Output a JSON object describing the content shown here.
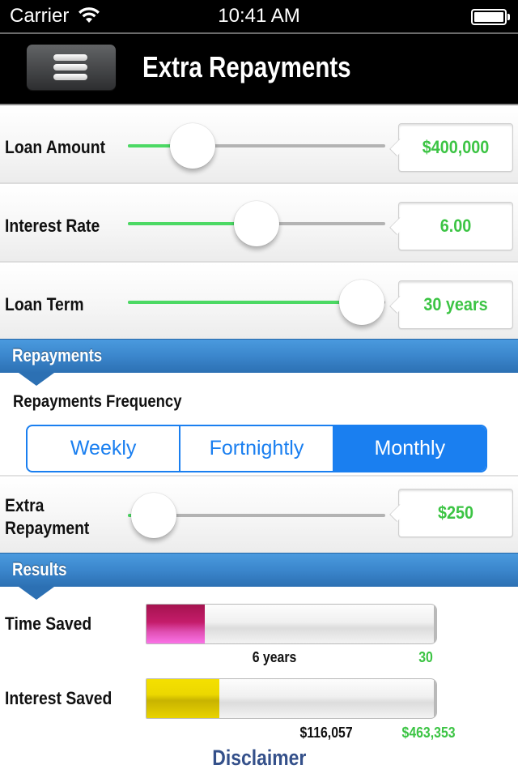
{
  "status_bar": {
    "carrier": "Carrier",
    "time": "10:41 AM",
    "battery_level": 1.0
  },
  "nav": {
    "title": "Extra Repayments",
    "menu_icon": "hamburger-menu-icon"
  },
  "sliders": {
    "loan_amount": {
      "label": "Loan Amount",
      "value": "$400,000",
      "fraction": 0.25
    },
    "interest_rate": {
      "label": "Interest Rate",
      "value": "6.00",
      "fraction": 0.5
    },
    "loan_term": {
      "label": "Loan Term",
      "value": "30 years",
      "fraction": 0.91
    },
    "extra_repayment": {
      "label_line1": "Extra",
      "label_line2": "Repayment",
      "value": "$250",
      "fraction": 0.1
    }
  },
  "repayments_section": {
    "title": "Repayments",
    "frequency_label": "Repayments Frequency",
    "options": [
      "Weekly",
      "Fortnightly",
      "Monthly"
    ],
    "selected": "Monthly"
  },
  "results_section": {
    "title": "Results",
    "time_saved": {
      "label": "Time Saved",
      "value": "6 years",
      "max": "30",
      "fraction": 0.2
    },
    "interest_saved": {
      "label": "Interest Saved",
      "value": "$116,057",
      "max": "$463,353",
      "fraction": 0.25
    }
  },
  "colors": {
    "accent_green": "#3cc444",
    "segment_blue": "#1a7ff0",
    "header_blue": "#3b86cc",
    "time_bar": "#c41c6a",
    "interest_bar": "#ecd800",
    "disclaimer": "#34508a"
  },
  "footer": {
    "disclaimer": "Disclaimer"
  }
}
